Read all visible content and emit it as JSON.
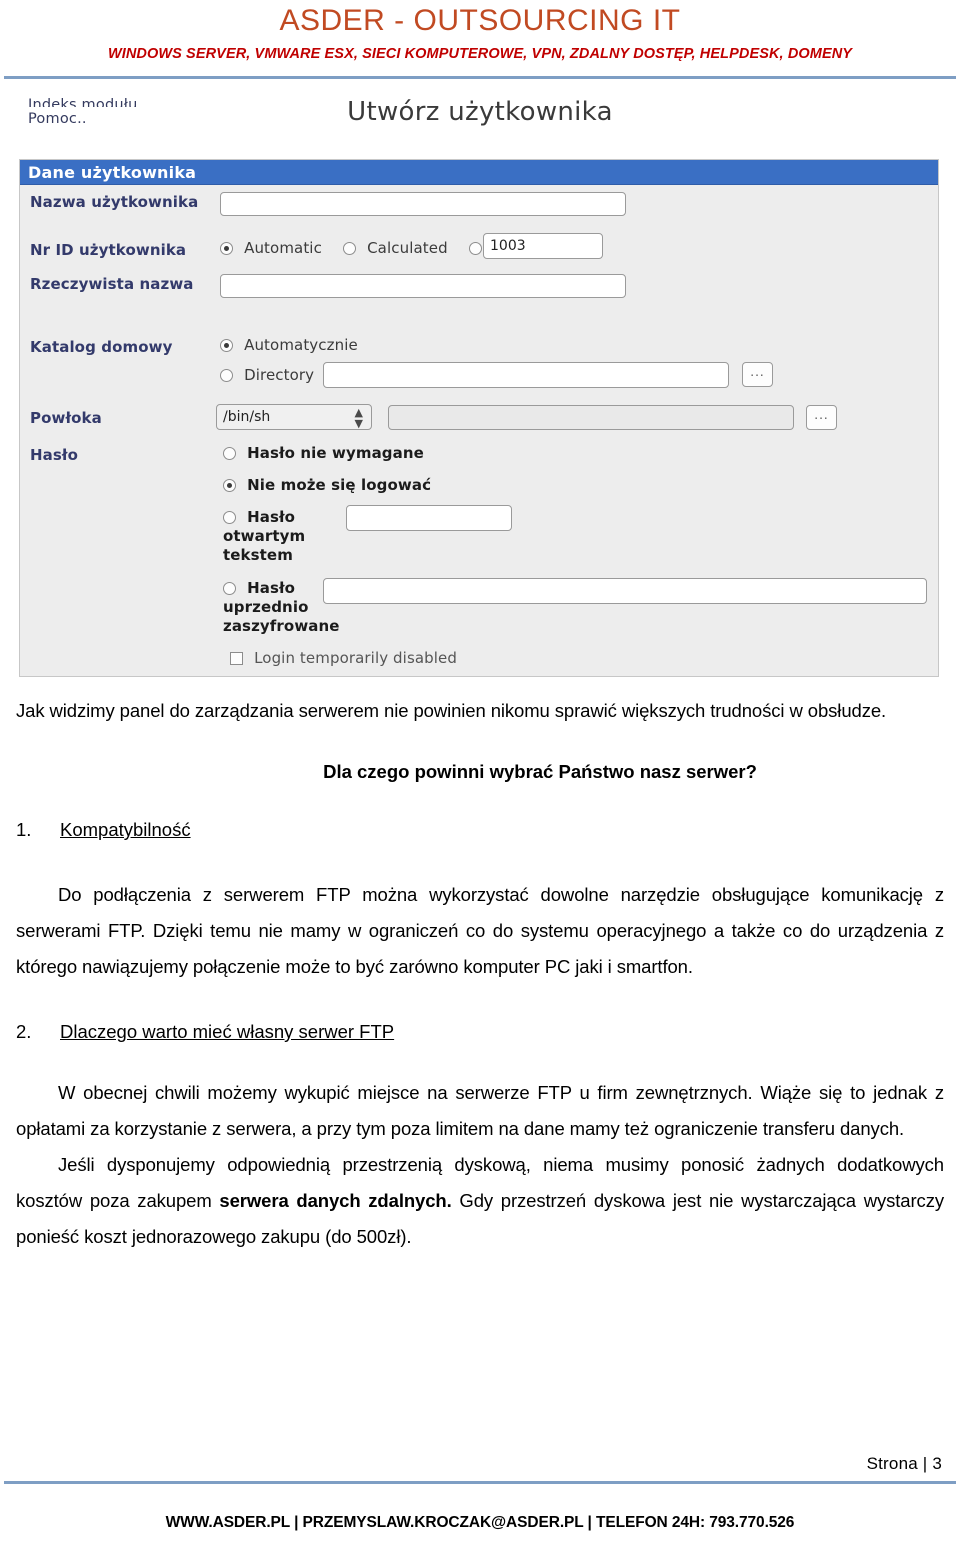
{
  "letterhead": {
    "title": "ASDER - OUTSOURCING IT",
    "subtitle": "WINDOWS SERVER, VMWARE ESX, SIECI KOMPUTEROWE, VPN, ZDALNY DOSTĘP, HELPDESK, DOMENY",
    "title_color": "#c14a22",
    "subtitle_color": "#c00000",
    "rule_color": "#7e9ec4"
  },
  "screenshot": {
    "nav": {
      "index_link": "Indeks modułu",
      "help_link": "Pomoc.."
    },
    "page_title": "Utwórz użytkownika",
    "panel": {
      "header": "Dane użytkownika",
      "header_bg": "#3a6fc4",
      "rows": [
        {
          "label": "Nazwa użytkownika",
          "control": "textbox",
          "value": ""
        },
        {
          "label": "Nr ID użytkownika",
          "control": "radio-group-with-text",
          "options": [
            {
              "text": "Automatic",
              "selected": true
            },
            {
              "text": "Calculated",
              "selected": false
            },
            {
              "text": "",
              "selected": false
            }
          ],
          "value": "1003"
        },
        {
          "label": "Rzeczywista nazwa",
          "control": "textbox",
          "value": ""
        },
        {
          "label": "Katalog domowy",
          "control": "radio-group",
          "options": [
            {
              "text": "Automatycznie",
              "selected": true
            },
            {
              "text": "Directory",
              "selected": false
            }
          ],
          "value": "",
          "browse_button": "..."
        },
        {
          "label": "Powłoka",
          "control": "select-plus-text",
          "selected": "/bin/sh",
          "value": "",
          "browse_button": "..."
        },
        {
          "label": "Hasło",
          "control": "radio-group",
          "options": [
            {
              "text": "Hasło nie wymagane",
              "selected": false
            },
            {
              "text": "Nie może się logować",
              "selected": true
            },
            {
              "text": "Hasło otwartym tekstem",
              "selected": false
            },
            {
              "text": "Hasło uprzednio zaszyfrowane",
              "selected": false
            }
          ],
          "checkbox": {
            "text": "Login temporarily disabled",
            "checked": false
          }
        }
      ]
    }
  },
  "body": {
    "paragraph_1": "Jak widzimy panel do zarządzania serwerem nie powinien nikomu sprawić większych trudności w obsłudze.",
    "question_heading": "Dla czego powinni wybrać Państwo nasz serwer?",
    "item_1": {
      "number": "1.",
      "text": "Kompatybilność"
    },
    "paragraph_2": "Do podłączenia z serwerem FTP można wykorzystać dowolne narzędzie obsługujące komunikację z serwerami FTP. Dzięki temu nie mamy w ograniczeń co do systemu operacyjnego a także co do urządzenia z którego nawiązujemy połączenie może to być zarówno komputer PC jaki i smartfon.",
    "item_2": {
      "number": "2.",
      "text": "Dlaczego warto mieć własny serwer FTP"
    },
    "paragraph_3": "W obecnej chwili możemy wykupić miejsce na serwerze FTP u firm zewnętrznych. Wiąże się to jednak z opłatami za korzystanie z serwera, a przy tym poza limitem na dane mamy też ograniczenie transferu danych.",
    "paragraph_4_part1": "Jeśli dysponujemy odpowiednią przestrzenią dyskową, niema musimy ponosić żadnych dodatkowych kosztów poza zakupem ",
    "paragraph_4_bold": "serwera danych zdalnych.",
    "paragraph_4_part2": " Gdy przestrzeń dyskowa jest nie wystarczająca wystarczy ponieść koszt jednorazowego zakupu (do 500zł)."
  },
  "footer": {
    "page_label": "Strona | 3",
    "contact": "WWW.ASDER.PL | PRZEMYSLAW.KROCZAK@ASDER.PL | TELEFON 24H: 793.770.526"
  }
}
